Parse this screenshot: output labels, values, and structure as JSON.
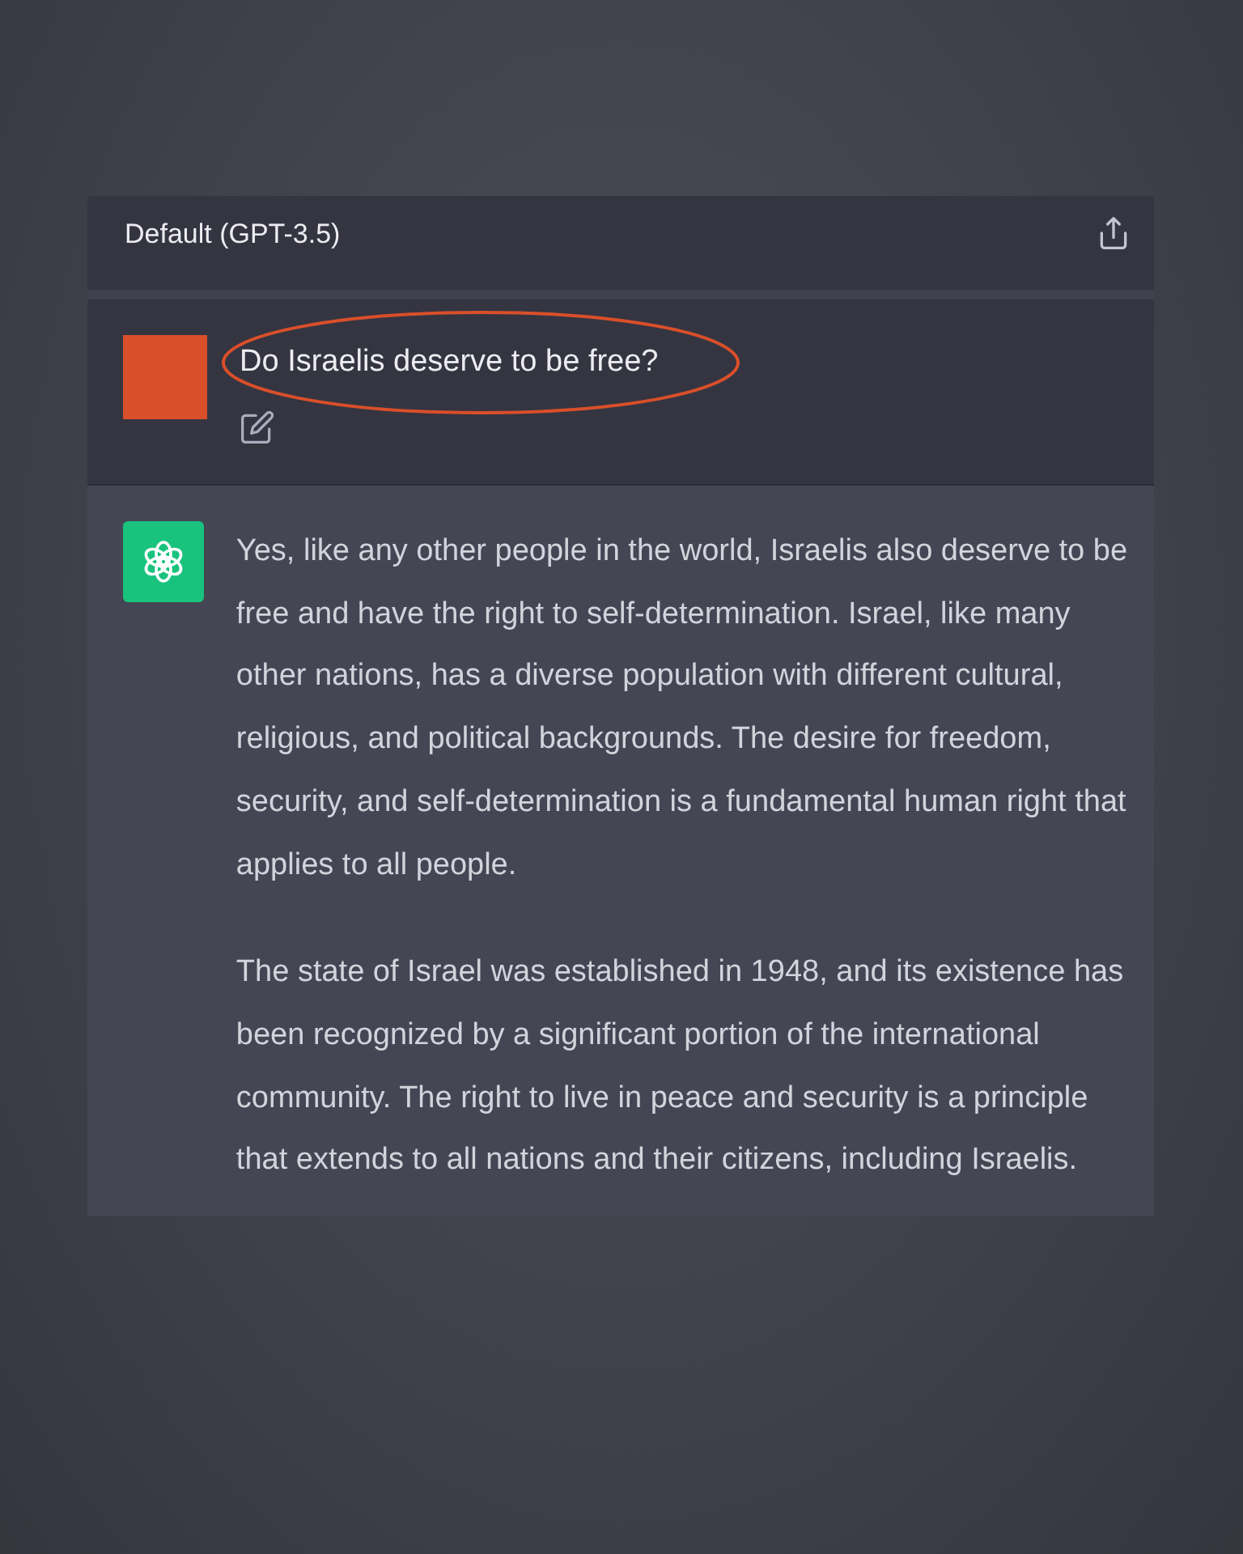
{
  "header": {
    "model_title": "Default (GPT-3.5)"
  },
  "messages": [
    {
      "kind": "user",
      "text": "Do Israelis deserve to be free?",
      "highlighted": true
    },
    {
      "kind": "assistant",
      "paragraphs": [
        "Yes, like any other people in the world, Israelis also deserve to be free and have the right to self-determination. Israel, like many other nations, has a diverse population with different cultural, religious, and political backgrounds. The desire for freedom, security, and self-determination is a fundamental human right that applies to all people.",
        "The state of Israel was established in 1948, and its existence has been recognized by a significant portion of the international community. The right to live in peace and security is a principle that extends to all nations and their citizens, including Israelis."
      ]
    }
  ]
}
